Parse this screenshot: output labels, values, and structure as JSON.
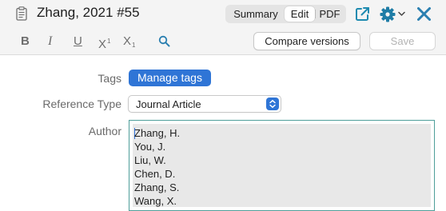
{
  "header": {
    "title": "Zhang, 2021 #55",
    "tabs": [
      {
        "label": "Summary",
        "selected": false
      },
      {
        "label": "Edit",
        "selected": true
      },
      {
        "label": "PDF",
        "selected": false
      }
    ],
    "icons": [
      "document-icon",
      "open-external-icon",
      "gear-icon",
      "chevron-down-icon",
      "close-icon"
    ]
  },
  "toolbar": {
    "bold": "B",
    "italic": "I",
    "underline": "U",
    "superscript": {
      "base": "X",
      "mark": "1"
    },
    "subscript": {
      "base": "X",
      "mark": "1"
    },
    "compare_label": "Compare versions",
    "save_label": "Save"
  },
  "form": {
    "tags_label": "Tags",
    "manage_tags_label": "Manage tags",
    "ref_type_label": "Reference Type",
    "ref_type_value": "Journal Article",
    "author_label": "Author",
    "authors": [
      "Zhang, H.",
      "You, J.",
      "Liu, W.",
      "Chen, D.",
      "Zhang, S.",
      "Wang, X."
    ]
  },
  "colors": {
    "accent": "#2f75d6",
    "close": "#2a7fb0",
    "focus_border": "#4f9e9a",
    "toolbar_bg": "#f4f4f4"
  }
}
